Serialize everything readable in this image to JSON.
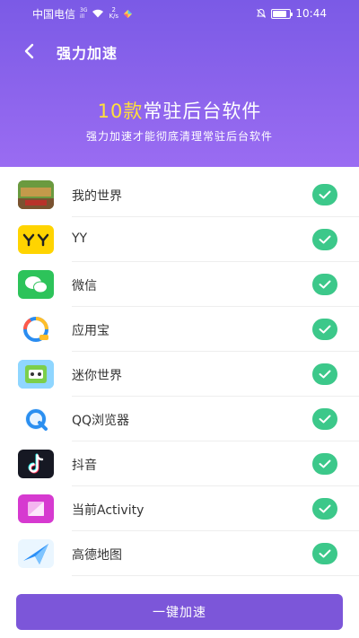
{
  "status_bar": {
    "carrier": "中国电信",
    "network_type": "3G",
    "network_strength": "ill",
    "speed_value": "2",
    "speed_unit": "K/s",
    "time": "10:44"
  },
  "header": {
    "title": "强力加速",
    "headline_count": "10款",
    "headline_rest": "常驻后台软件",
    "subline": "强力加速才能彻底清理常驻后台软件"
  },
  "apps": [
    {
      "name": "我的世界",
      "icon": "minecraft-icon"
    },
    {
      "name": "YY",
      "icon": "yy-icon"
    },
    {
      "name": "微信",
      "icon": "wechat-icon"
    },
    {
      "name": "应用宝",
      "icon": "yingyongbao-icon"
    },
    {
      "name": "迷你世界",
      "icon": "mini-world-icon"
    },
    {
      "name": "QQ浏览器",
      "icon": "qq-browser-icon"
    },
    {
      "name": "抖音",
      "icon": "douyin-icon"
    },
    {
      "name": "当前Activity",
      "icon": "current-activity-icon"
    },
    {
      "name": "高德地图",
      "icon": "amap-icon"
    }
  ],
  "footer": {
    "button_label": "一键加速"
  },
  "colors": {
    "header": "#8c64ec",
    "accent_yellow": "#ffe03a",
    "check_green": "#3cc88a",
    "button": "#7c56d9"
  }
}
